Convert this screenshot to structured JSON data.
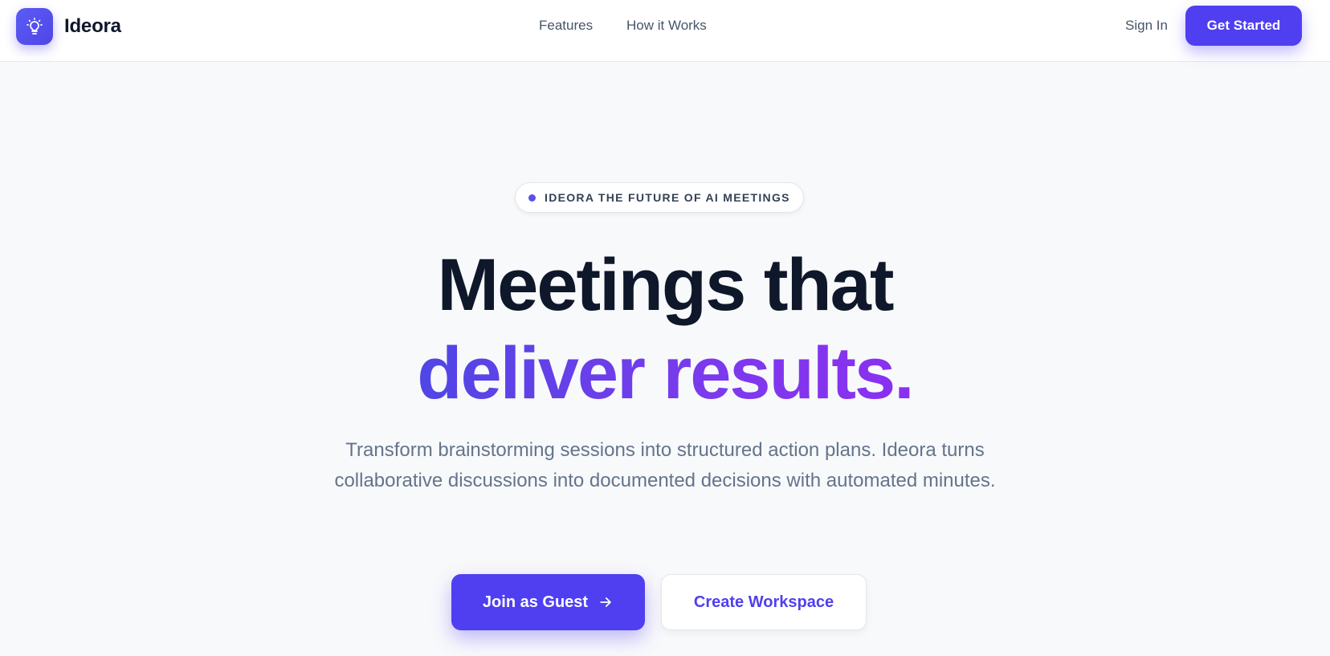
{
  "header": {
    "brand": "Ideora",
    "logo_icon": "lightbulb-icon",
    "nav": [
      {
        "label": "Features"
      },
      {
        "label": "How it Works"
      }
    ],
    "sign_in": "Sign In",
    "get_started": "Get Started"
  },
  "hero": {
    "badge": "IDEORA THE FUTURE OF AI MEETINGS",
    "headline_line1": "Meetings that",
    "headline_line2": "deliver results.",
    "subtitle": "Transform brainstorming sessions into structured action plans. Ideora turns collaborative discussions into documented decisions with automated minutes.",
    "primary_button": "Join as Guest",
    "primary_button_icon": "arrow-right-icon",
    "secondary_button": "Create Workspace"
  },
  "colors": {
    "accent": "#4f3ff0",
    "gradient_start": "#4f46e5",
    "gradient_end": "#8b2ff0",
    "background": "#f8f9fb",
    "heading": "#0f172a",
    "muted": "#64748b"
  }
}
